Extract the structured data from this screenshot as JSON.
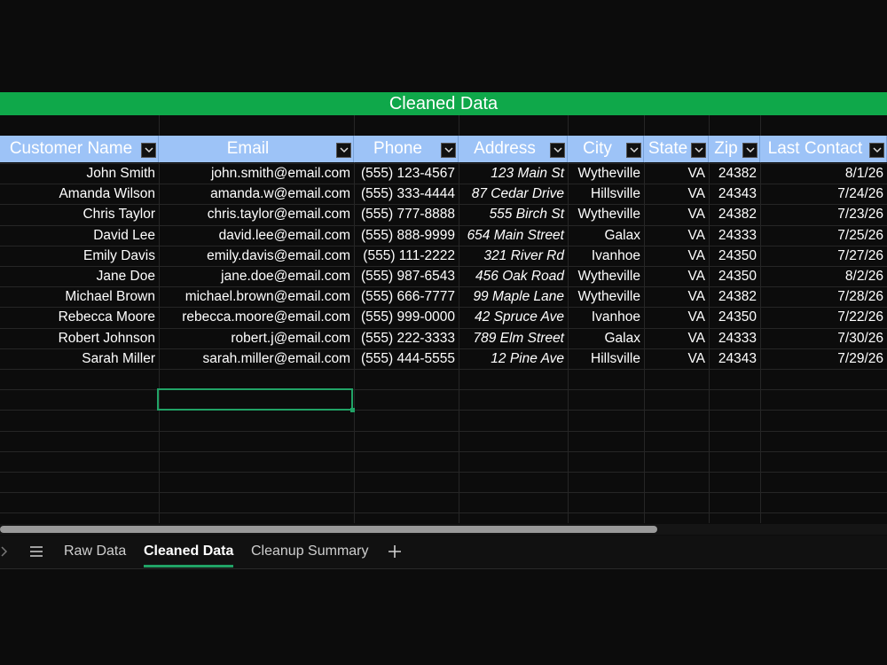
{
  "sheet": {
    "banner_title": "Cleaned Data",
    "columns": [
      {
        "label": "Customer Name"
      },
      {
        "label": "Email"
      },
      {
        "label": "Phone"
      },
      {
        "label": "Address"
      },
      {
        "label": "City"
      },
      {
        "label": "State"
      },
      {
        "label": "Zip"
      },
      {
        "label": "Last Contact"
      }
    ],
    "rows": [
      [
        "John Smith",
        "john.smith@email.com",
        "(555) 123-4567",
        "123 Main St",
        "Wytheville",
        "VA",
        "24382",
        "8/1/26"
      ],
      [
        "Amanda Wilson",
        "amanda.w@email.com",
        "(555) 333-4444",
        "87 Cedar Drive",
        "Hillsville",
        "VA",
        "24343",
        "7/24/26"
      ],
      [
        "Chris Taylor",
        "chris.taylor@email.com",
        "(555) 777-8888",
        "555 Birch St",
        "Wytheville",
        "VA",
        "24382",
        "7/23/26"
      ],
      [
        "David Lee",
        "david.lee@email.com",
        "(555) 888-9999",
        "654 Main Street",
        "Galax",
        "VA",
        "24333",
        "7/25/26"
      ],
      [
        "Emily Davis",
        "emily.davis@email.com",
        "(555) 111-2222",
        "321 River Rd",
        "Ivanhoe",
        "VA",
        "24350",
        "7/27/26"
      ],
      [
        "Jane Doe",
        "jane.doe@email.com",
        "(555) 987-6543",
        "456 Oak Road",
        "Wytheville",
        "VA",
        "24350",
        "8/2/26"
      ],
      [
        "Michael Brown",
        "michael.brown@email.com",
        "(555) 666-7777",
        "99 Maple Lane",
        "Wytheville",
        "VA",
        "24382",
        "7/28/26"
      ],
      [
        "Rebecca Moore",
        "rebecca.moore@email.com",
        "(555) 999-0000",
        "42 Spruce Ave",
        "Ivanhoe",
        "VA",
        "24350",
        "7/22/26"
      ],
      [
        "Robert Johnson",
        "robert.j@email.com",
        "(555) 222-3333",
        "789 Elm Street",
        "Galax",
        "VA",
        "24333",
        "7/30/26"
      ],
      [
        "Sarah Miller",
        "sarah.miller@email.com",
        "(555) 444-5555",
        "12 Pine Ave",
        "Hillsville",
        "VA",
        "24343",
        "7/29/26"
      ]
    ]
  },
  "tabs": {
    "items": [
      {
        "label": "Raw Data",
        "active": false
      },
      {
        "label": "Cleaned Data",
        "active": true
      },
      {
        "label": "Cleanup Summary",
        "active": false
      }
    ],
    "add_icon": "plus-icon",
    "menu_icon": "hamburger-icon",
    "scroll_icon": "chevron-right-icon"
  },
  "colors": {
    "banner": "#0fa84a",
    "header": "#9dc3f7",
    "selection": "#21a366"
  }
}
